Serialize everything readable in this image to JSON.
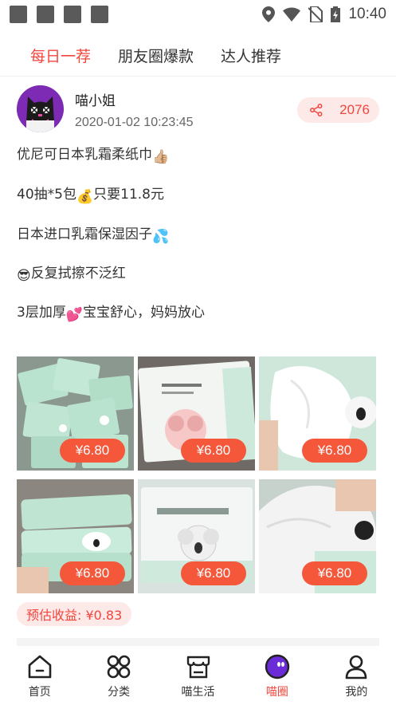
{
  "status_bar": {
    "time": "10:40"
  },
  "tabs": [
    {
      "label": "每日一荐",
      "active": true
    },
    {
      "label": "朋友圈爆款",
      "active": false
    },
    {
      "label": "达人推荐",
      "active": false
    }
  ],
  "post": {
    "author": "喵小姐",
    "timestamp": "2020-01-02 10:23:45",
    "share_count": "2076",
    "lines": [
      {
        "text": "优尼可日本乳霜柔纸巾",
        "emoji": "👍🏼",
        "emoji_pos": "after"
      },
      {
        "text": "40抽*5包",
        "emoji": "💰",
        "emoji_pos": "middle",
        "text_after": "只要11.8元"
      },
      {
        "text": "日本进口乳霜保湿因子",
        "emoji": "💦",
        "emoji_pos": "after"
      },
      {
        "text": "反复拭擦不泛红",
        "emoji": "😎",
        "emoji_pos": "before"
      },
      {
        "text": "3层加厚",
        "emoji": "💕",
        "emoji_pos": "middle",
        "text_after": "宝宝舒心，妈妈放心"
      }
    ],
    "images": [
      {
        "price": "¥6.80"
      },
      {
        "price": "¥6.80"
      },
      {
        "price": "¥6.80"
      },
      {
        "price": "¥6.80"
      },
      {
        "price": "¥6.80"
      },
      {
        "price": "¥6.80"
      }
    ],
    "estimated_earnings": "预估收益: ¥0.83"
  },
  "bottom_nav": [
    {
      "label": "首页",
      "icon": "home-icon",
      "active": false
    },
    {
      "label": "分类",
      "icon": "category-icon",
      "active": false
    },
    {
      "label": "喵生活",
      "icon": "shop-icon",
      "active": false
    },
    {
      "label": "喵圈",
      "icon": "cat-circle-icon",
      "active": true
    },
    {
      "label": "我的",
      "icon": "user-icon",
      "active": false
    }
  ],
  "colors": {
    "accent": "#f2463d",
    "accent_bg": "#fde9e8",
    "price_tag": "#f5573b",
    "tissue_green": "#b9e3cf"
  }
}
